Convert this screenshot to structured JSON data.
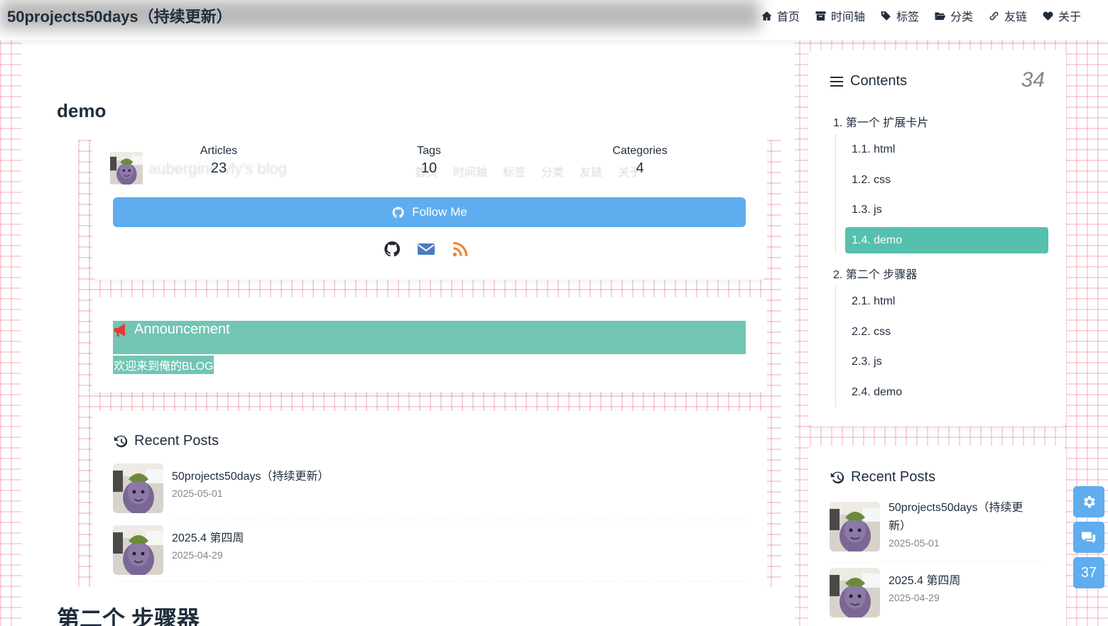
{
  "header": {
    "site_title": "50projects50days（持续更新）",
    "menu": [
      {
        "label": "首页",
        "icon": "home-icon"
      },
      {
        "label": "时间轴",
        "icon": "archive-icon"
      },
      {
        "label": "标签",
        "icon": "tags-icon"
      },
      {
        "label": "分类",
        "icon": "folder-open-icon"
      },
      {
        "label": "友链",
        "icon": "link-icon"
      },
      {
        "label": "关于",
        "icon": "heart-icon"
      }
    ]
  },
  "article": {
    "demo_heading": "demo",
    "next_heading": "第二个 步骤器",
    "author_card": {
      "ghost_name": "aubergine-vly's blog",
      "ghost_menu": [
        "首页",
        "时间轴",
        "标签",
        "分类",
        "友链",
        "关于"
      ],
      "stats": [
        {
          "label": "Articles",
          "value": "23"
        },
        {
          "label": "Tags",
          "value": "10"
        },
        {
          "label": "Categories",
          "value": "4"
        }
      ],
      "follow_label": "Follow Me",
      "social_icons": [
        "github-icon",
        "email-icon",
        "rss-icon"
      ]
    },
    "announcement": {
      "title": "Announcement",
      "text": "欢迎来到俺的BLOG"
    },
    "recent_posts": {
      "title": "Recent Posts",
      "posts": [
        {
          "title": "50projects50days（持续更新）",
          "date": "2025-05-01"
        },
        {
          "title": "2025.4 第四周",
          "date": "2025-04-29"
        }
      ]
    }
  },
  "sidebar": {
    "toc": {
      "title": "Contents",
      "count": "34",
      "items": [
        {
          "label": "1. 第一个 扩展卡片",
          "level": 1
        },
        {
          "label": "1.1. html",
          "level": 2
        },
        {
          "label": "1.2. css",
          "level": 2
        },
        {
          "label": "1.3. js",
          "level": 2
        },
        {
          "label": "1.4. demo",
          "level": 2,
          "active": true
        },
        {
          "label": "2. 第二个 步骤器",
          "level": 1
        },
        {
          "label": "2.1. html",
          "level": 2
        },
        {
          "label": "2.2. css",
          "level": 2
        },
        {
          "label": "2.3. js",
          "level": 2
        },
        {
          "label": "2.4. demo",
          "level": 2
        }
      ]
    },
    "recent_posts": {
      "title": "Recent Posts",
      "posts": [
        {
          "title_line1": "50projects50days（持续更",
          "title_line2": "新）",
          "date": "2025-05-01"
        },
        {
          "title_line1": "2025.4 第四周",
          "title_line2": "",
          "date": "2025-04-29"
        }
      ]
    }
  },
  "float_buttons": {
    "settings_icon": "gear-icon",
    "comments_icon": "comments-icon",
    "scroll_percent": "37"
  },
  "colors": {
    "accent_blue": "#5fadee",
    "toc_active": "#55c0ad",
    "announcement_bg": "#72c5b3",
    "grid_line": "#e77080"
  }
}
